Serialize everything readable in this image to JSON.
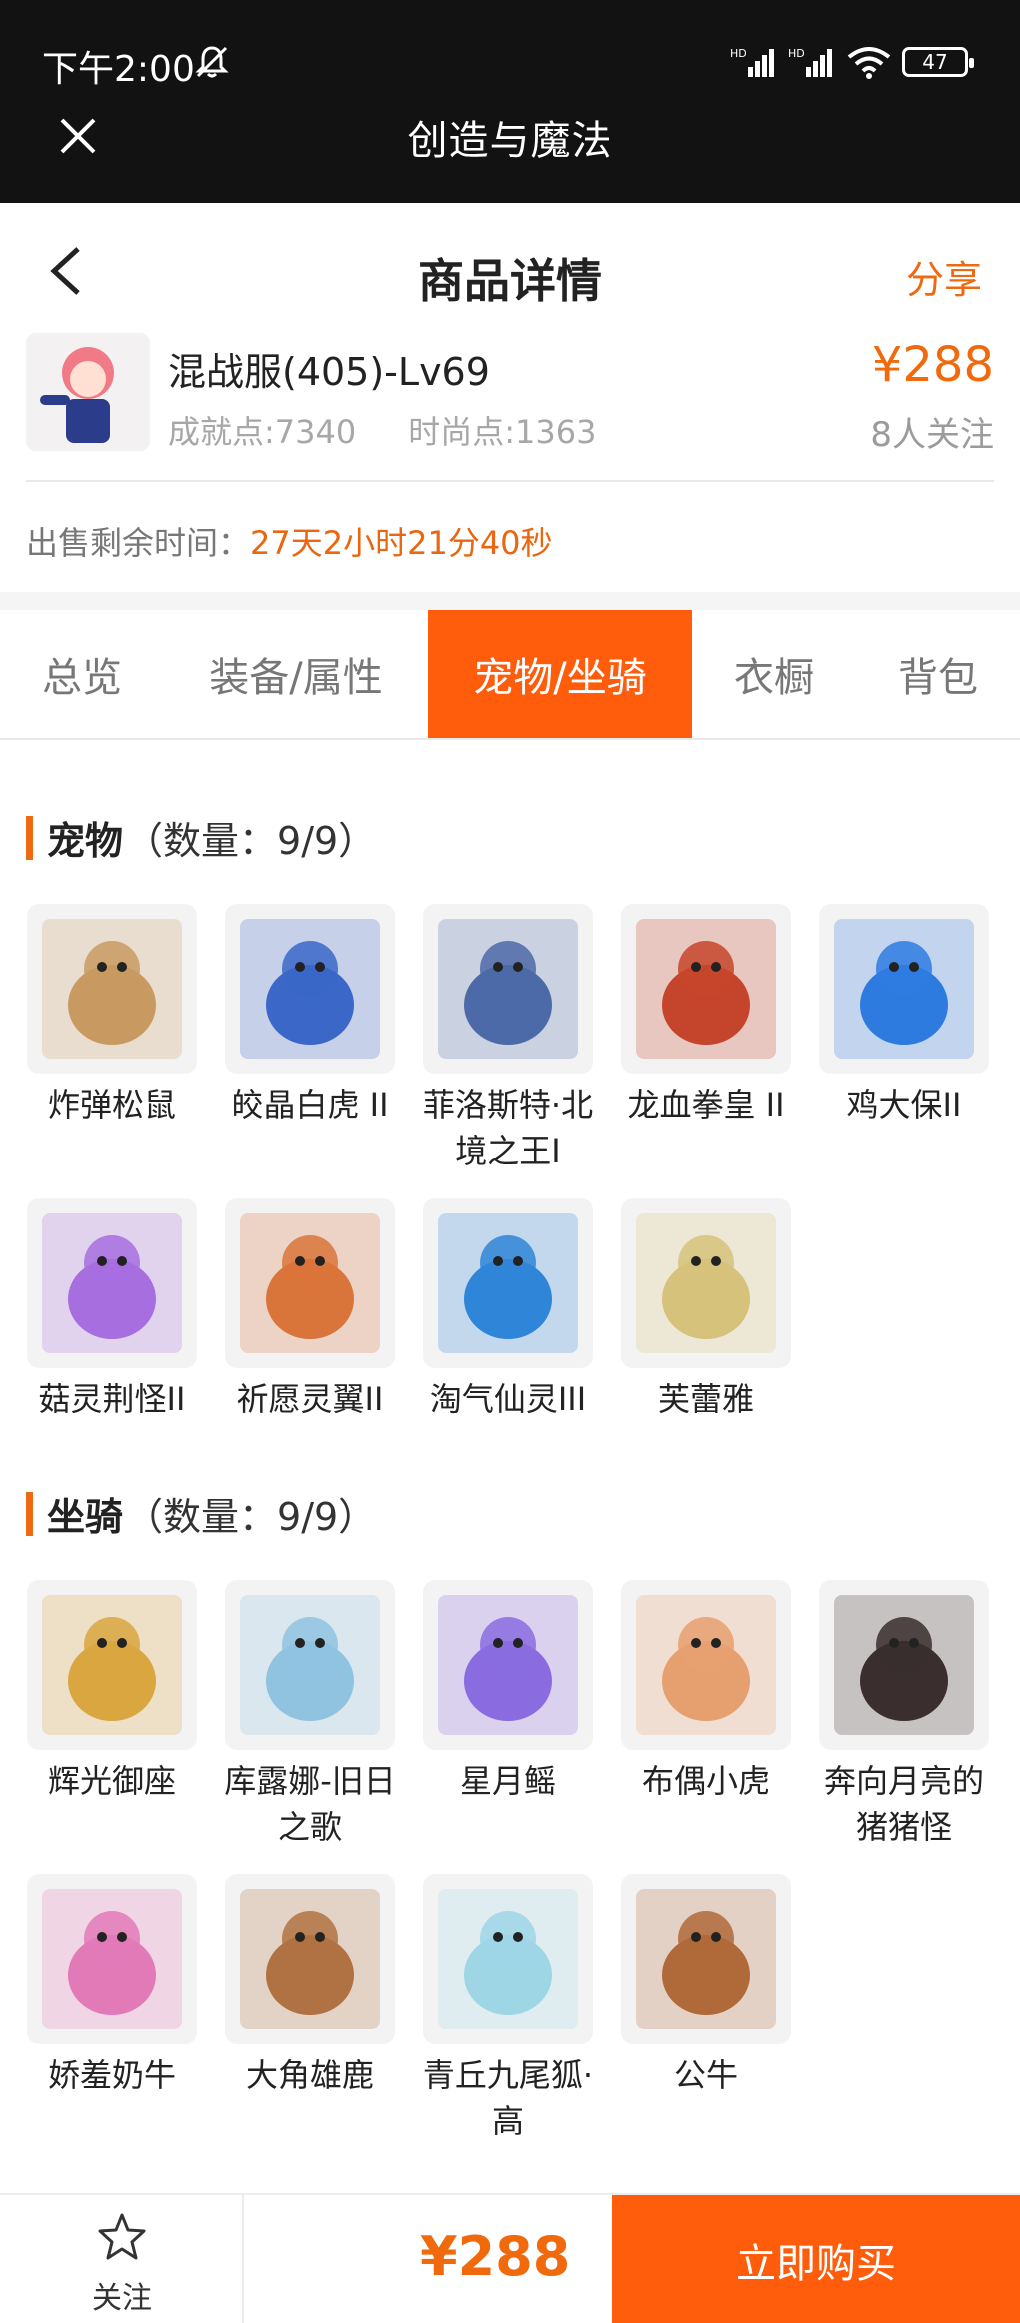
{
  "status_bar": {
    "time": "下午2:00",
    "battery": "47",
    "signal_1": "HD",
    "signal_2": "HD"
  },
  "app": {
    "title": "创造与魔法"
  },
  "nav": {
    "title": "商品详情",
    "share": "分享"
  },
  "product": {
    "name": "混战服(405)-Lv69",
    "achievement": "成就点:7340",
    "fashion": "时尚点:1363",
    "price": "¥288",
    "followers": "8人关注"
  },
  "remaining": {
    "label": "出售剩余时间：",
    "value": "27天2小时21分40秒"
  },
  "tabs": [
    {
      "label": "总览",
      "active": false
    },
    {
      "label": "装备/属性",
      "active": false
    },
    {
      "label": "宠物/坐骑",
      "active": true
    },
    {
      "label": "衣橱",
      "active": false
    },
    {
      "label": "背包",
      "active": false
    }
  ],
  "pets": {
    "title": "宠物",
    "count": "（数量：9/9）",
    "items": [
      {
        "name": "炸弹松鼠",
        "color": "#c89a62"
      },
      {
        "name": "皎晶白虎 II",
        "color": "#3a67c8"
      },
      {
        "name": "菲洛斯特·北境之王I",
        "color": "#4d6aa8"
      },
      {
        "name": "龙血拳皇 II",
        "color": "#c5452c"
      },
      {
        "name": "鸡大保II",
        "color": "#2e7be0"
      },
      {
        "name": "菇灵荆怪II",
        "color": "#a76ee0"
      },
      {
        "name": "祈愿灵翼II",
        "color": "#d9743a"
      },
      {
        "name": "淘气仙灵III",
        "color": "#2f86d8"
      },
      {
        "name": "芙蕾雅",
        "color": "#d6c27a"
      }
    ]
  },
  "mounts": {
    "title": "坐骑",
    "count": "（数量：9/9）",
    "items": [
      {
        "name": "辉光御座",
        "color": "#d9a640"
      },
      {
        "name": "库露娜-旧日之歌",
        "color": "#8fc3e0"
      },
      {
        "name": "星月鳐",
        "color": "#8a6ce0"
      },
      {
        "name": "布偶小虎",
        "color": "#e6a070"
      },
      {
        "name": "奔向月亮的猪猪怪",
        "color": "#3a2e2e"
      },
      {
        "name": "娇羞奶牛",
        "color": "#e27ab8"
      },
      {
        "name": "大角雄鹿",
        "color": "#b07242"
      },
      {
        "name": "青丘九尾狐·高",
        "color": "#9fd6e6"
      },
      {
        "name": "公牛",
        "color": "#b06a3a"
      }
    ]
  },
  "bottom": {
    "follow": "关注",
    "price": "¥288",
    "buy": "立即购买"
  },
  "colors": {
    "accent": "#ff5d0b",
    "price": "#f06a0d",
    "topbar": "#121212"
  }
}
